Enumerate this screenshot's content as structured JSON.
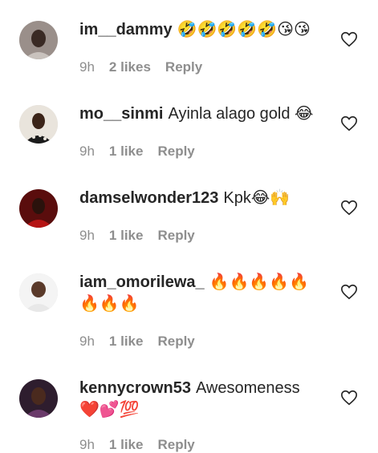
{
  "comments": [
    {
      "username": "im__dammy",
      "text": "🤣🤣🤣🤣🤣😘😘",
      "time": "9h",
      "likes": "2 likes",
      "reply": "Reply",
      "avatar": "avatar-woman-dark",
      "colors": {
        "bg": "#9a8f8a",
        "face": "#3a2a24",
        "cloth": "#c9c2bd"
      }
    },
    {
      "username": "mo__sinmi",
      "text": "Ayinla alago gold 😂",
      "time": "9h",
      "likes": "1 like",
      "reply": "Reply",
      "avatar": "avatar-woman-patterned",
      "colors": {
        "bg": "#e9e4dc",
        "face": "#3b2418",
        "cloth": "#1b1b1b"
      }
    },
    {
      "username": "damselwonder123",
      "text": "Kpk😂🙌",
      "time": "9h",
      "likes": "1 like",
      "reply": "Reply",
      "avatar": "avatar-woman-red",
      "colors": {
        "bg": "#5a0d0d",
        "face": "#2a120c",
        "cloth": "#b51414"
      }
    },
    {
      "username": "iam_omorilewa_",
      "text": "🔥🔥🔥🔥🔥🔥🔥🔥",
      "time": "9h",
      "likes": "1 like",
      "reply": "Reply",
      "avatar": "avatar-woman-white",
      "colors": {
        "bg": "#f4f4f4",
        "face": "#5a3a2a",
        "cloth": "#e8e8e8"
      }
    },
    {
      "username": "kennycrown53",
      "text": "Awesomeness ❤️💕💯",
      "time": "9h",
      "likes": "1 like",
      "reply": "Reply",
      "avatar": "avatar-woman-smiling",
      "colors": {
        "bg": "#2e1d2e",
        "face": "#4a2a1e",
        "cloth": "#6a3a6a"
      }
    }
  ],
  "icons": {
    "heart": "heart-outline-icon"
  }
}
